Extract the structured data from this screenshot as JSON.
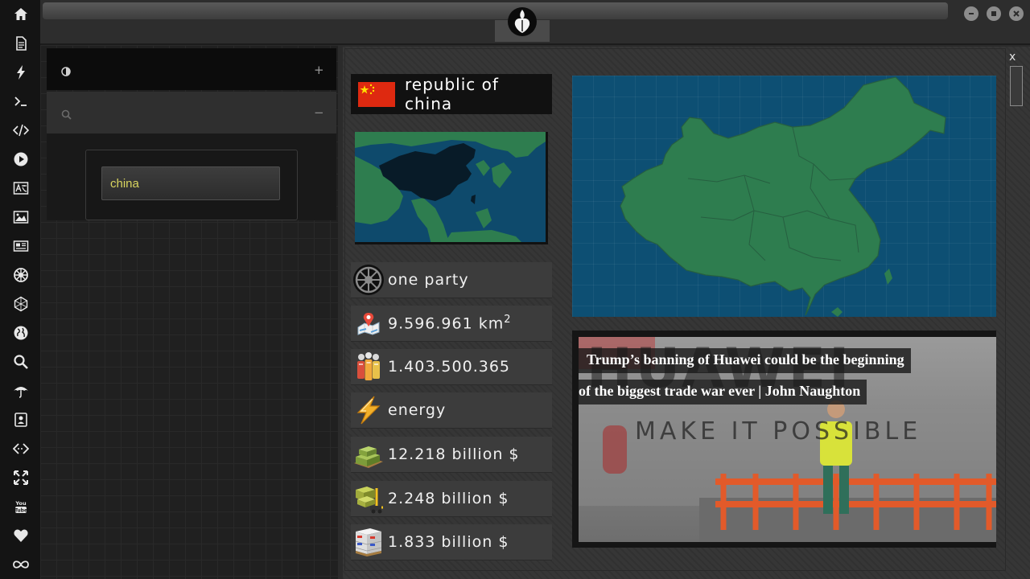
{
  "sidebar": {
    "icons": [
      "home-icon",
      "document-icon",
      "bolt-icon",
      "terminal-icon",
      "code-icon",
      "play-icon",
      "translate-icon",
      "image-icon",
      "newspaper-icon",
      "galactic-empire-icon",
      "rebel-network-icon",
      "globe-icon",
      "search-icon",
      "umbrella-icon",
      "contacts-icon",
      "exchange-icon",
      "fullscreen-icon",
      "youtube-icon",
      "heart-icon",
      "infinity-icon"
    ]
  },
  "window": {
    "title": "",
    "controls": [
      "minimize",
      "maximize",
      "close"
    ]
  },
  "panel": {
    "row1_icon": "contrast-icon",
    "row1_action": "+",
    "row2_icon": "search-icon",
    "row2_action": "−",
    "search_value": "china"
  },
  "country": {
    "name": "republic of china",
    "flag_colors": {
      "red": "#de2910",
      "yellow": "#ffde00"
    },
    "stats": [
      {
        "icon": "empire-emblem-icon",
        "text": "one party"
      },
      {
        "icon": "map-pin-icon",
        "text": "9.596.961 km",
        "sup": "2"
      },
      {
        "icon": "population-icon",
        "text": "1.403.500.365"
      },
      {
        "icon": "energy-bolt-icon",
        "text": "energy"
      },
      {
        "icon": "money-pallet-icon",
        "text": "12.218 billion $"
      },
      {
        "icon": "forklift-crates-icon",
        "text": "2.248 billion $"
      },
      {
        "icon": "shipping-boxes-icon",
        "text": "1.833 billion $"
      }
    ]
  },
  "main": {
    "close_label": "x"
  },
  "news": {
    "headline_line1": "Trump’s banning of Huawei could be the beginning",
    "headline_line2": "of the biggest trade war ever | John Naughton",
    "bg_brand": "HUAWEI",
    "bg_slogan": "MAKE IT POSSIBLE"
  },
  "colors": {
    "ocean": "#0d4f73",
    "land": "#2e7d4f",
    "search_text": "#d9d55f"
  }
}
